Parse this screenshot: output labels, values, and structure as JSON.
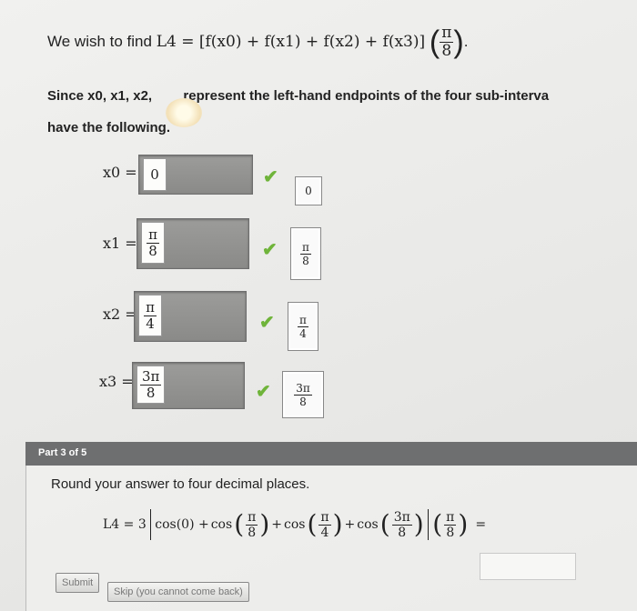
{
  "header": {
    "lead": "We wish to find",
    "expression": "L4 = [f(x0) + f(x1) + f(x2) + f(x3)]",
    "frac_num": "π",
    "frac_den": "8",
    "period": "."
  },
  "intro": {
    "line1_vars": "Since x0, x1, x2,",
    "line1_rest": "represent the left-hand endpoints of the four sub-interva",
    "line2": "have the following."
  },
  "rows": [
    {
      "label": "x0 =",
      "num": "0",
      "den": "",
      "answer_num": "0",
      "answer_den": ""
    },
    {
      "label": "x1 =",
      "num": "π",
      "den": "8",
      "answer_num": "π",
      "answer_den": "8"
    },
    {
      "label": "x2 =",
      "num": "π",
      "den": "4",
      "answer_num": "π",
      "answer_den": "4"
    },
    {
      "label": "x3 =",
      "num": "3π",
      "den": "8",
      "answer_num": "3π",
      "answer_den": "8"
    }
  ],
  "check_glyph": "✔",
  "part": {
    "label": "Part 3 of 5",
    "instruction": "Round your answer to four decimal places.",
    "formula": {
      "lhs": "L4 = 3",
      "cos0": "cos(0) +",
      "cos_prefix": "cos",
      "plus": "+",
      "t1_num": "π",
      "t1_den": "8",
      "t2_num": "π",
      "t2_den": "4",
      "t3_num": "3π",
      "t3_den": "8",
      "mult_num": "π",
      "mult_den": "8",
      "equals": "="
    },
    "final_value": ""
  },
  "buttons": {
    "submit": "Submit",
    "skip": "Skip (you cannot come back)"
  },
  "colors": {
    "check": "#6fb43a",
    "part_bar": "#6e6f70"
  }
}
